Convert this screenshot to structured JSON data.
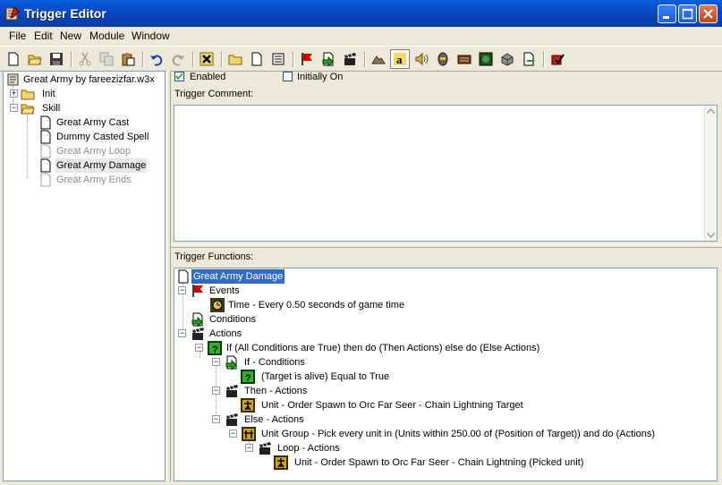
{
  "window": {
    "title": "Trigger Editor"
  },
  "menu": [
    "File",
    "Edit",
    "New",
    "Module",
    "Window"
  ],
  "toolbar": {
    "buttons": [
      "new-icon",
      "open-icon",
      "save-icon",
      "cut-icon",
      "copy-icon",
      "paste-icon",
      "undo-icon",
      "redo-icon",
      "delete-icon",
      "new-category-icon",
      "new-trigger-icon",
      "new-comment-icon",
      "new-event-icon",
      "new-condition-icon",
      "new-action-icon",
      "terrain-editor-icon",
      "trigger-editor-icon",
      "sound-editor-icon",
      "object-editor-icon",
      "campaign-editor-icon",
      "ai-editor-icon",
      "object-manager-icon",
      "import-manager-icon",
      "test-map-icon"
    ]
  },
  "tree": {
    "map": "Great Army by fareezizfar.w3x",
    "categories": [
      {
        "label": "Init",
        "expander": "+"
      },
      {
        "label": "Skill",
        "expander": "−"
      }
    ],
    "triggers": [
      {
        "label": "Great Army Cast",
        "enabled": true
      },
      {
        "label": "Dummy Casted Spell",
        "enabled": true
      },
      {
        "label": "Great Army Loop",
        "enabled": false
      },
      {
        "label": "Great Army Damage",
        "enabled": true,
        "selected": true
      },
      {
        "label": "Great Army Ends",
        "enabled": false
      }
    ]
  },
  "options": {
    "enabled_label": "Enabled",
    "enabled_checked": true,
    "initially_on_label": "Initially On",
    "initially_on_checked": false,
    "comment_label": "Trigger Comment:",
    "functions_label": "Trigger Functions:"
  },
  "functions": {
    "root": "Great Army Damage",
    "events": "Events",
    "event_1": "Time - Every 0.50 seconds of game time",
    "conditions": "Conditions",
    "actions": "Actions",
    "if_then_else": "If (All Conditions are True) then do (Then Actions) else do (Else Actions)",
    "if_conditions": "If - Conditions",
    "if_condition_1": "(Target is alive) Equal to True",
    "then_actions": "Then - Actions",
    "then_action_1": "Unit - Order Spawn to Orc Far Seer - Chain Lightning Target",
    "else_actions": "Else - Actions",
    "group_pick": "Unit Group - Pick every unit in (Units within 250.00 of (Position of Target)) and do (Actions)",
    "loop_actions": "Loop - Actions",
    "loop_action_1": "Unit - Order Spawn to Orc Far Seer - Chain Lightning (Picked unit)"
  },
  "colors": {
    "titlebar": "#0842b8",
    "selection": "#316ac5",
    "disabled_text": "#8c8c8c",
    "event_flag": "#d40000"
  }
}
